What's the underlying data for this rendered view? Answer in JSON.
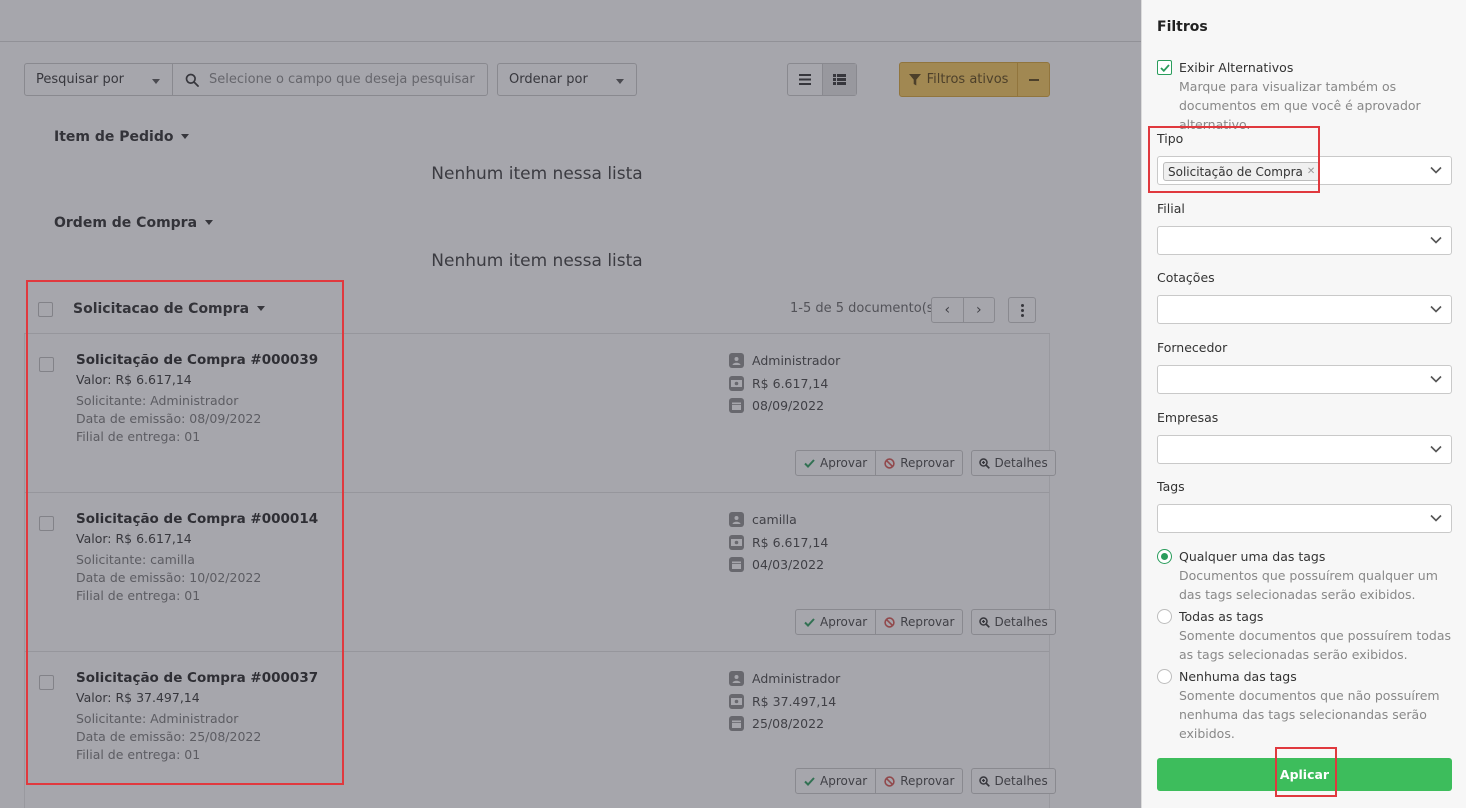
{
  "toolbar": {
    "search_by_label": "Pesquisar por",
    "search_placeholder": "Selecione o campo que deseja pesquisar",
    "order_by_label": "Ordenar por",
    "filters_button_label": "Filtros ativos"
  },
  "groups": [
    {
      "title": "Item de Pedido",
      "empty_message": "Nenhum item nessa lista"
    },
    {
      "title": "Ordem de Compra",
      "empty_message": "Nenhum item nessa lista"
    }
  ],
  "section": {
    "title": "Solicitacao de Compra",
    "pager_count": "1-5 de 5 documento(s)",
    "prev": "‹",
    "next": "›"
  },
  "documents": [
    {
      "title": "Solicitação de Compra #000039",
      "value": "Valor: R$ 6.617,14",
      "requester": "Solicitante: Administrador",
      "issue_date": "Data de emissão: 08/09/2022",
      "delivery_branch": "Filial de entrega: 01",
      "side_user": "Administrador",
      "side_amount": "R$ 6.617,14",
      "side_date": "08/09/2022"
    },
    {
      "title": "Solicitação de Compra #000014",
      "value": "Valor: R$ 6.617,14",
      "requester": "Solicitante: camilla",
      "issue_date": "Data de emissão: 10/02/2022",
      "delivery_branch": "Filial de entrega: 01",
      "side_user": "camilla",
      "side_amount": "R$ 6.617,14",
      "side_date": "04/03/2022"
    },
    {
      "title": "Solicitação de Compra #000037",
      "value": "Valor: R$ 37.497,14",
      "requester": "Solicitante: Administrador",
      "issue_date": "Data de emissão: 25/08/2022",
      "delivery_branch": "Filial de entrega: 01",
      "side_user": "Administrador",
      "side_amount": "R$ 37.497,14",
      "side_date": "25/08/2022"
    }
  ],
  "actions": {
    "approve": "Aprovar",
    "reject": "Reprovar",
    "details": "Detalhes"
  },
  "panel": {
    "title": "Filtros",
    "show_alternatives_label": "Exibir Alternativos",
    "show_alternatives_checked": true,
    "show_alternatives_help": "Marque para visualizar também os documentos em que você é aprovador alternativo.",
    "type_label": "Tipo",
    "type_selected_tag": "Solicitação de Compra",
    "branch_label": "Filial",
    "quotes_label": "Cotações",
    "supplier_label": "Fornecedor",
    "companies_label": "Empresas",
    "tags_label": "Tags",
    "tag_modes": [
      {
        "label": "Qualquer uma das tags",
        "help": "Documentos que possuírem qualquer um das tags selecionadas serão exibidos.",
        "selected": true
      },
      {
        "label": "Todas as tags",
        "help": "Somente documentos que possuírem todas as tags selecionadas serão exibidos.",
        "selected": false
      },
      {
        "label": "Nenhuma das tags",
        "help": "Somente documentos que não possuírem nenhuma das tags selecionandas serão exibidos.",
        "selected": false
      }
    ],
    "apply_label": "Aplicar"
  },
  "colors": {
    "overlay": "#3c3e4a",
    "filters_button": "#f6c85a",
    "apply_button": "#3dbd5c",
    "accent_green": "#2a9d5c",
    "annotation_red": "#e0393e"
  }
}
